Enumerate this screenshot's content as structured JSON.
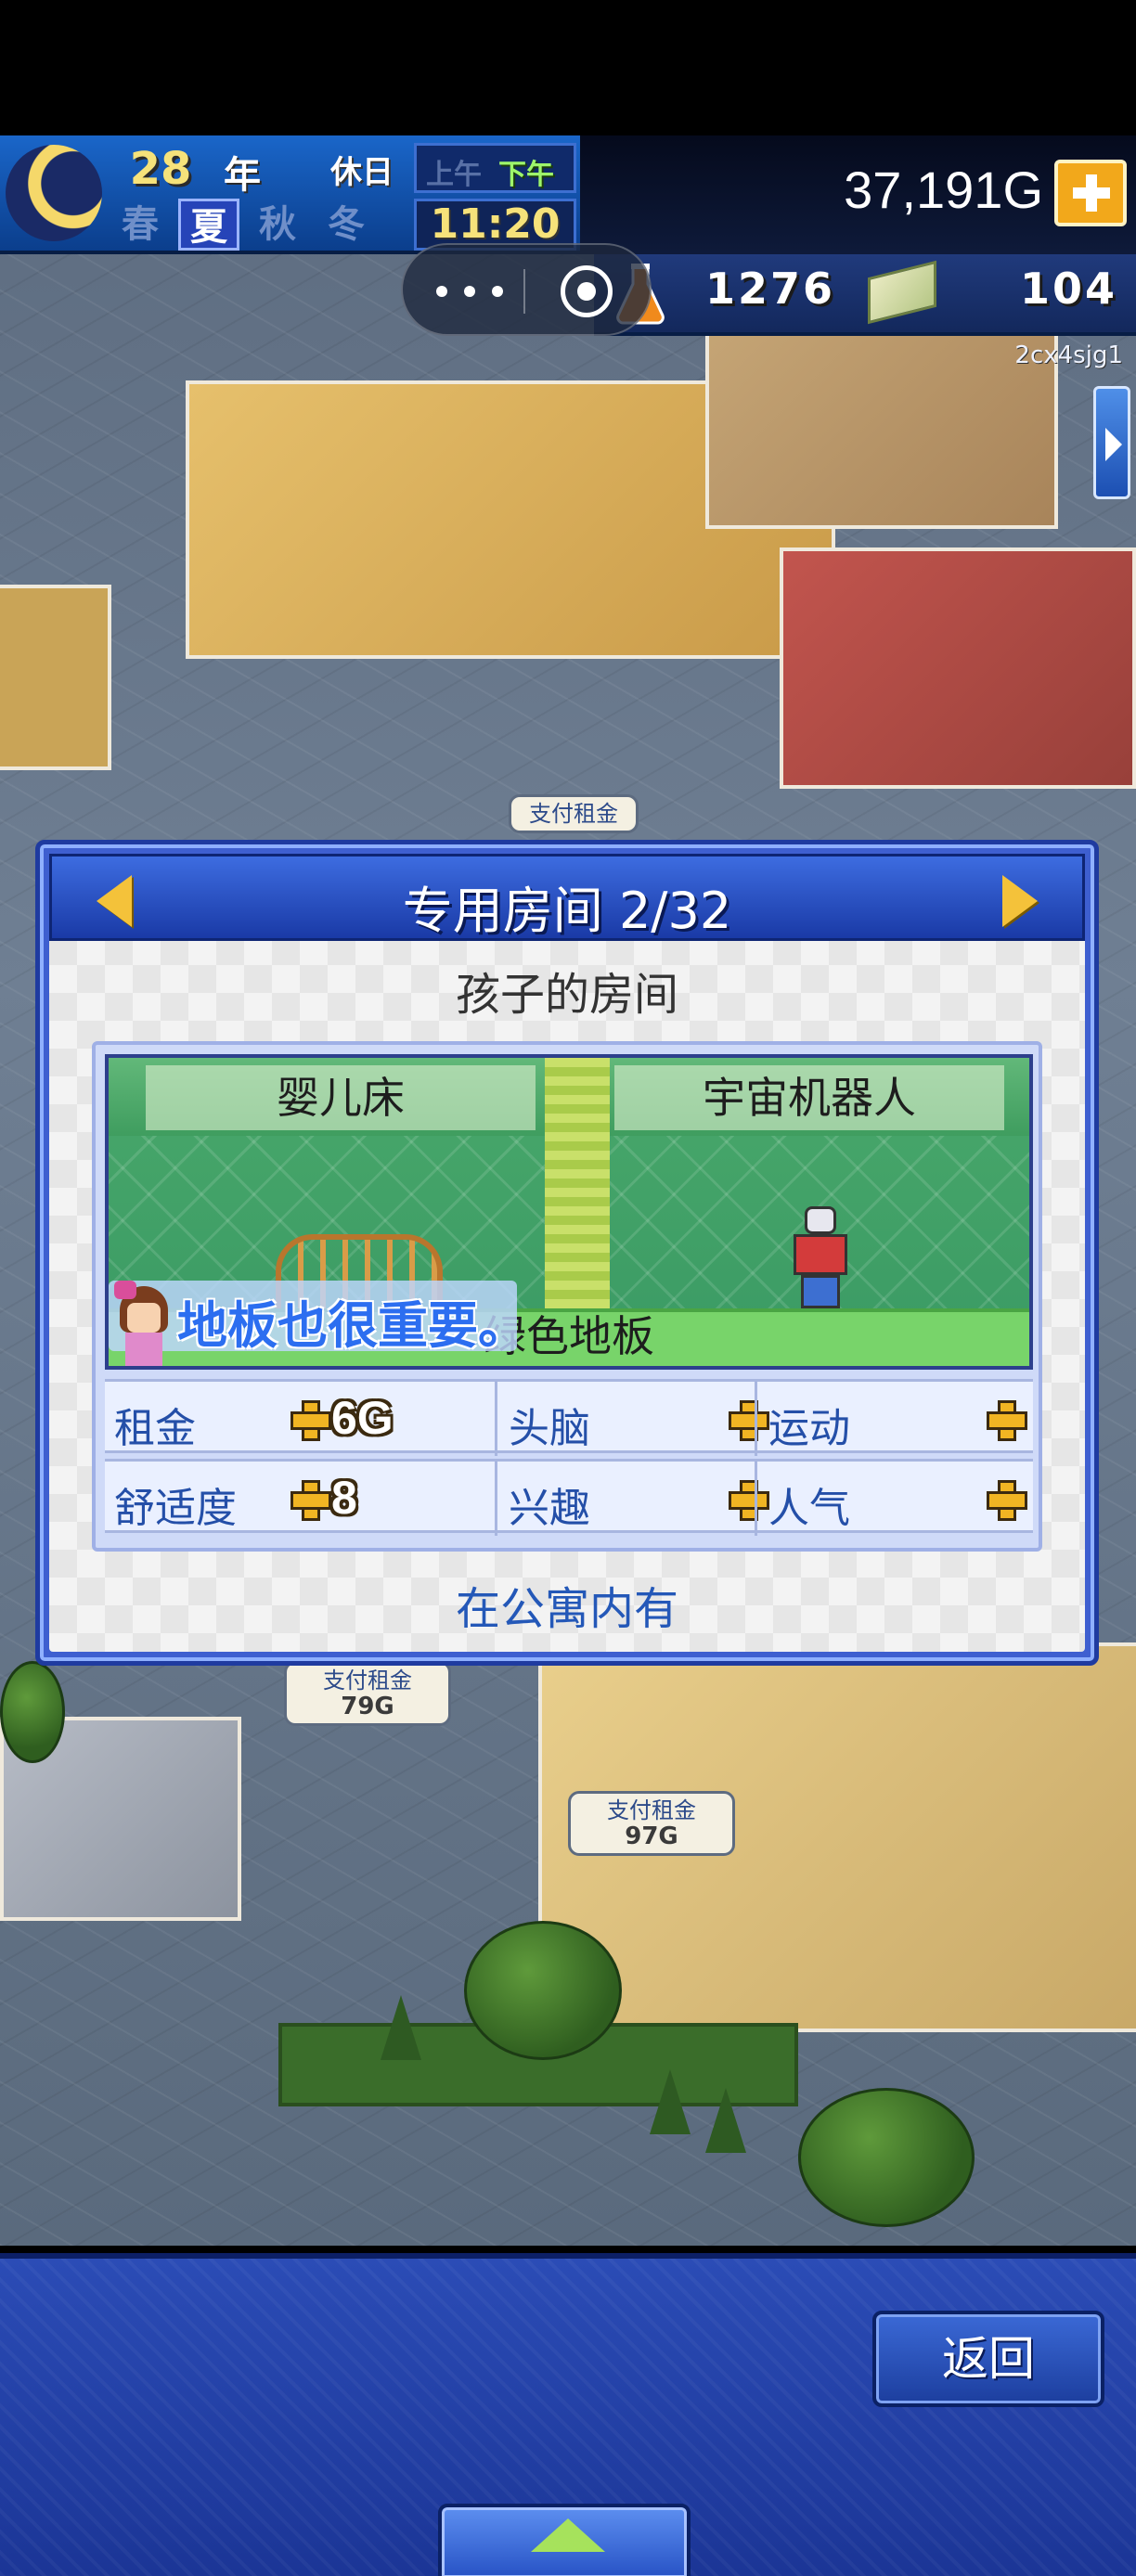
{
  "hud": {
    "year": "28",
    "year_unit": "年",
    "holiday": "休日",
    "am": "上午",
    "pm": "下午",
    "seasons": [
      "春",
      "夏",
      "秋",
      "冬"
    ],
    "active_season": "夏",
    "time": "11:20",
    "money": "37,191G",
    "research_points": "1276",
    "tickets": "104",
    "user_id": "2cx4sjg1"
  },
  "world": {
    "rent_tags": [
      {
        "label": "支付租金",
        "amount": ""
      },
      {
        "label": "支付租金",
        "amount": "79G"
      },
      {
        "label": "支付租金",
        "amount": "97G"
      }
    ]
  },
  "panel": {
    "title": "专用房间 2/32",
    "room_name": "孩子的房间",
    "items": [
      "婴儿床",
      "宇宙机器人"
    ],
    "floor": "绿色地板",
    "tip": "地板也很重要。",
    "stats": {
      "rent_label": "租金",
      "rent_value": "6G",
      "brain_label": "头脑",
      "exercise_label": "运动",
      "comfort_label": "舒适度",
      "comfort_value": "8",
      "hobby_label": "兴趣",
      "popularity_label": "人气"
    },
    "footer": "在公寓内有"
  },
  "bottom": {
    "back_label": "返回"
  },
  "colors": {
    "panel_blue": "#3e5fd0",
    "gold": "#f4c23a",
    "stat_label": "#244fa8",
    "tip_text": "#2c6ef0"
  },
  "icons": [
    "moon-icon",
    "plus-icon",
    "flask-icon",
    "cash-icon",
    "more-dots-icon",
    "close-target-icon",
    "left-arrow-icon",
    "right-arrow-icon",
    "up-arrow-icon"
  ]
}
